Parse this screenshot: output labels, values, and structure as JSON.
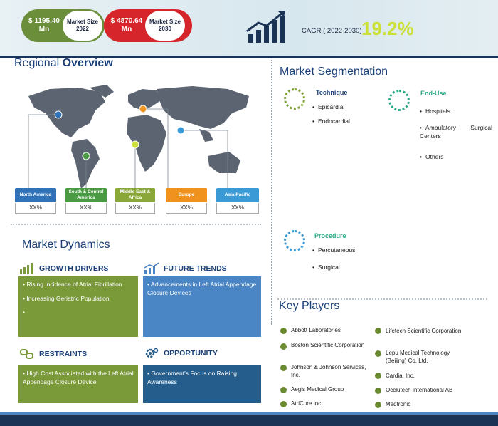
{
  "header": {
    "size_2022_value": "$ 1195.40 Mn",
    "size_2022_label": "Market Size 2022",
    "size_2030_value": "$ 4870.64 Mn",
    "size_2030_label": "Market Size 2030",
    "cagr_label": "CAGR ( 2022-2030)",
    "cagr_value": "19.2%"
  },
  "regional": {
    "title_a": "Regional ",
    "title_b": "Overview",
    "regions": [
      {
        "name": "North America",
        "value": "XX%",
        "color": "#2f72b8"
      },
      {
        "name": "South & Central America",
        "value": "XX%",
        "color": "#4a9a44"
      },
      {
        "name": "Middle East & Africa",
        "value": "XX%",
        "color": "#8aa83a"
      },
      {
        "name": "Europe",
        "value": "XX%",
        "color": "#f0921e"
      },
      {
        "name": "Asia Pacific",
        "value": "XX%",
        "color": "#3a9ad6"
      }
    ]
  },
  "segmentation": {
    "title_a": "Market ",
    "title_b": "Segmentation",
    "technique": {
      "title": "Technique",
      "items": [
        "Epicardial",
        "Endocardial"
      ]
    },
    "end_use": {
      "title": "End-Use",
      "items": [
        "Hospitals",
        "Ambulatory Surgical Centers",
        "Others"
      ]
    },
    "procedure": {
      "title": "Procedure",
      "items": [
        "Percutaneous",
        "Surgical"
      ]
    }
  },
  "dynamics": {
    "title_a": "Market ",
    "title_b": "Dynamics",
    "growth_drivers": {
      "title": "GROWTH DRIVERS",
      "items": [
        "Rising Incidence of Atrial Fibrillation",
        "Increasing Geriatric Population",
        ""
      ]
    },
    "future_trends": {
      "title": "FUTURE TRENDS",
      "items": [
        "Advancements in Left Atrial Appendage Closure Devices"
      ]
    },
    "restraints": {
      "title": "RESTRAINTS",
      "items": [
        "High Cost Associated with the Left Atrial Appendage Closure Device"
      ]
    },
    "opportunity": {
      "title": "OPPORTUNITY",
      "items": [
        "Government's Focus on Raising Awareness"
      ]
    }
  },
  "players": {
    "title": "Key Players",
    "left": [
      "Abbott Laboratories",
      "Boston Scientific Corporation",
      "Johnson & Johnson Services, Inc.",
      "Aegis Medical Group",
      "AtriCure Inc."
    ],
    "right": [
      "Lifetech Scientific Corporation",
      "Lepu Medical Technology (Beijing) Co. Ltd.",
      "Cardia, Inc.",
      "Occlutech International AB",
      "Medtronic"
    ]
  }
}
